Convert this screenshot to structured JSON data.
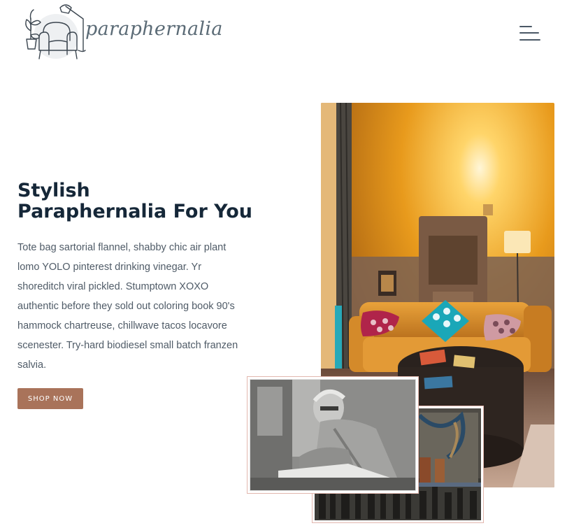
{
  "header": {
    "logo_text": "paraphernalia",
    "logo_icon": "armchair-plant-lamp-logo",
    "menu_icon": "hamburger-menu-icon"
  },
  "hero": {
    "title_line1": "Stylish",
    "title_line2": "Paraphernalia For You",
    "description": "Tote bag sartorial flannel, shabby chic air plant lomo YOLO pinterest drinking vinegar. Yr shoreditch viral pickled. Stumptown XOXO authentic before they sold out coloring book 90's hammock chartreuse, chillwave tacos locavore scenester. Try-hard biodiesel small batch franzen salvia.",
    "cta_label": "SHOP NOW"
  },
  "colors": {
    "heading": "#152738",
    "body_text": "#4f5b67",
    "cta_background": "#a9735a",
    "card_border": "#e2b7ae"
  }
}
